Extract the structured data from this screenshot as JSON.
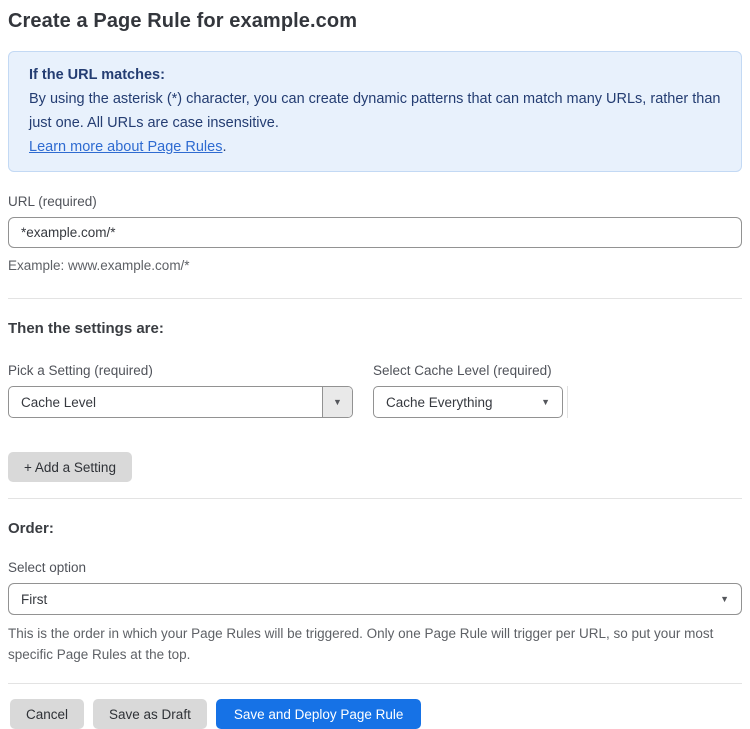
{
  "page": {
    "title": "Create a Page Rule for example.com"
  },
  "notice": {
    "heading": "If the URL matches:",
    "body": "By using the asterisk (*) character, you can create dynamic patterns that can match many URLs, rather than just one. All URLs are case insensitive.",
    "link_label": "Learn more about Page Rules",
    "link_suffix": "."
  },
  "url_field": {
    "label": "URL (required)",
    "value": "*example.com/*",
    "hint": "Example: www.example.com/*"
  },
  "settings_section": {
    "heading": "Then the settings are:",
    "setting_label": "Pick a Setting (required)",
    "setting_value": "Cache Level",
    "cache_label": "Select Cache Level (required)",
    "cache_value": "Cache Everything",
    "add_button_label": "+ Add a Setting"
  },
  "order_section": {
    "heading": "Order:",
    "label": "Select option",
    "value": "First",
    "hint": "This is the order in which your Page Rules will be triggered. Only one Page Rule will trigger per URL, so put your most specific Page Rules at the top."
  },
  "footer": {
    "cancel_label": "Cancel",
    "save_draft_label": "Save as Draft",
    "save_deploy_label": "Save and Deploy Page Rule"
  },
  "icons": {
    "chevron_down": "▼"
  },
  "colors": {
    "notice_bg": "#e8f1fc",
    "notice_border": "#c3d9f4",
    "notice_text": "#243d72",
    "link": "#2e6bd1",
    "primary_button": "#1672e6",
    "secondary_button": "#d9d9d9",
    "input_border": "#929292",
    "divider": "#e3e3e3"
  }
}
